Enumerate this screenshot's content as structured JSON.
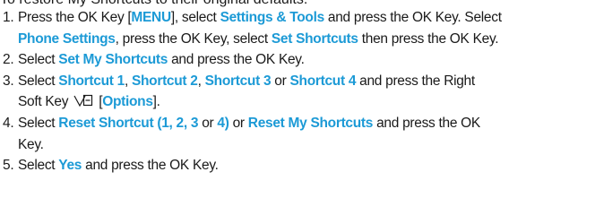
{
  "intro": "To restore My Shortcuts to their original defaults:",
  "steps": [
    {
      "number": "1.",
      "segments": [
        {
          "text": "Press the OK Key ["
        },
        {
          "text": "MENU",
          "hl": true
        },
        {
          "text": "], select "
        },
        {
          "text": "Settings & Tools",
          "hl": true
        },
        {
          "text": " and press the OK Key. Select "
        },
        {
          "br": true
        },
        {
          "text": "Phone Settings",
          "hl": true
        },
        {
          "text": ", press the OK Key, select "
        },
        {
          "text": "Set Shortcuts",
          "hl": true
        },
        {
          "text": " then press the OK Key."
        }
      ]
    },
    {
      "number": "2.",
      "segments": [
        {
          "text": "Select "
        },
        {
          "text": "Set My Shortcuts",
          "hl": true
        },
        {
          "text": " and press the OK Key."
        }
      ]
    },
    {
      "number": "3.",
      "segments": [
        {
          "text": "Select "
        },
        {
          "text": "Shortcut 1",
          "hl": true
        },
        {
          "text": ", "
        },
        {
          "text": "Shortcut 2",
          "hl": true
        },
        {
          "text": ", "
        },
        {
          "text": "Shortcut 3",
          "hl": true
        },
        {
          "text": " or "
        },
        {
          "text": "Shortcut 4",
          "hl": true
        },
        {
          "text": " and press the Right "
        },
        {
          "br": true
        },
        {
          "text": "Soft Key "
        },
        {
          "icon": "right-soft-key-icon"
        },
        {
          "text": " ["
        },
        {
          "text": "Options",
          "hl": true
        },
        {
          "text": "]."
        }
      ]
    },
    {
      "number": "4.",
      "segments": [
        {
          "text": "Select "
        },
        {
          "text": "Reset Shortcut (1, 2, 3",
          "hl": true
        },
        {
          "text": " or "
        },
        {
          "text": "4)",
          "hl": true
        },
        {
          "text": " or "
        },
        {
          "text": "Reset My Shortcuts",
          "hl": true
        },
        {
          "text": " and press the OK "
        },
        {
          "br": true
        },
        {
          "text": "Key."
        }
      ]
    },
    {
      "number": "5.",
      "segments": [
        {
          "text": "Select "
        },
        {
          "text": "Yes",
          "hl": true
        },
        {
          "text": " and press the OK Key."
        }
      ]
    }
  ],
  "colors": {
    "highlight": "#1c9ad6",
    "text": "#1a1a1a"
  }
}
